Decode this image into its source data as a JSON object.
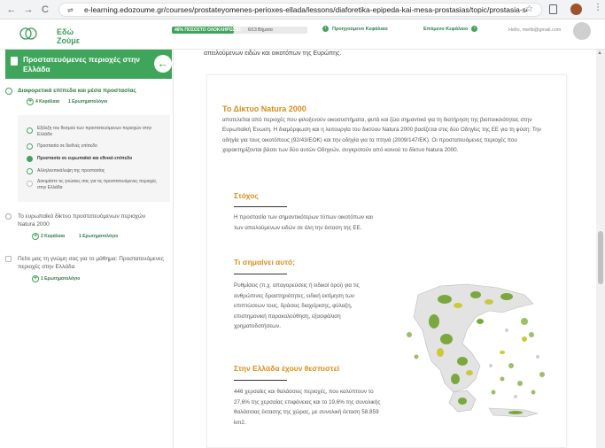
{
  "browser": {
    "back": "←",
    "forward": "→",
    "reload": "C",
    "url": "e-learning.edozoume.gr/courses/prostateyomenes-perioxes-ellada/lessons/diaforetika-epipeda-kai-mesa-prostasias/topic/prostasia-se-eyropaiko-kai-ethniko...",
    "star": "☆"
  },
  "header": {
    "logo_text": "Εδώ Ζούμε",
    "progress_label": "46% ΠΟΣΟΣΤΟ ΟΛΟΚΛΗΡΩΣΗΣ",
    "progress_count": "6/13 Βήματα",
    "progress_value": 0.46,
    "prev_label": "Προηγούμενο Κεφάλαιο",
    "next_label": "Επόμενο Κεφάλαιο",
    "user_email": "Hello, melib@gmail.com"
  },
  "sidebar": {
    "title": "Προστατευόμενες περιοχές στην Ελλάδα",
    "units": [
      {
        "title": "Διαφορετικά επίπεδα και μέσα προστασίας",
        "chapters": "4 Κεφάλαια",
        "quizzes": "1 Ερωτηματολόγιο"
      },
      {
        "title": "Το ευρωπαϊκό δίκτυο προστατευόμενων περιοχών Natura 2000",
        "chapters": "2 Κεφάλαια",
        "quizzes": "1 Ερωτηματολόγιο"
      },
      {
        "title": "Πείτε μας τη γνώμη σας για το μάθημα: Προστατευόμενες περιοχές στην Ελλάδα",
        "quizzes": "1 Ερωτηματολόγιο"
      }
    ],
    "subitems": [
      "Εξέλιξη του θεσμού των προστατευόμενων περιοχών στην Ελλάδα",
      "Προστασία σε διεθνές επίπεδο",
      "Προστασία σε ευρωπαϊκό και εθνικό επίπεδο",
      "Αλληλοεπικάλυψη της προστασίας",
      "Δοκιμάστε τις γνώσεις σας για τις προστατευόμενες περιοχές στην Ελλάδα"
    ]
  },
  "main": {
    "top_line": "απειλούμενων ειδών και οικοτόπων της Ευρώπης.",
    "natura_title": "Το Δίκτυο Natura 2000",
    "natura_body": "αποτελείται από περιοχές που φιλοξενούν οικοσυστήματα, φυτά και ζώα σημαντικά για τη διατήρηση της βιοποικιλότητας στην Ευρωπαϊκή Ένωση. Η διαμόρφωση και η λειτουργία του δικτύου Natura 2000 βασίζεται στις δύο Οδηγίες της ΕΕ για τη φύση: Την οδηγία για τους οικοτόπους (92/43/ΕΟΚ) και την οδηγία για τα πτηνά (2009/147/ΕΚ). Οι προστατευόμενες περιοχές που χαρακτηρίζονται βάσει των δύο αυτών Οδηγιών, συγκροτούν από κοινού το δίκτυο Natura 2000.",
    "goal_title": "Στόχος",
    "goal_body": "Η προστασία των σημαντικότερων τύπων οικοτόπων και των απειλούμενων ειδών σε όλη την έκταση της ΕΕ.",
    "means_title": "Τι σημαίνει αυτό;",
    "means_body": "Ρυθμίσεις (π.χ. απαγορεύσεις ή ειδικοί όροι) για τις ανθρώπινες δραστηριότητες, ειδική εκτίμηση των επιπτώσεων τους, δράσεις διαχείρισης, φύλαξη, επιστημονική παρακολούθηση, εξασφάλιση χρηματοδοτήσεων.",
    "greece_title": "Στην Ελλάδα έχουν θεσπιστεί",
    "greece_body": "446 χερσαίες και θαλάσσιες περιοχές, που καλύπτουν το 27,6% της χερσαίας επιφάνειας και το 19,6% της συνολικής θαλάσσιας έκτασης της χώρας, με συνολική έκταση 58.859 km2."
  }
}
